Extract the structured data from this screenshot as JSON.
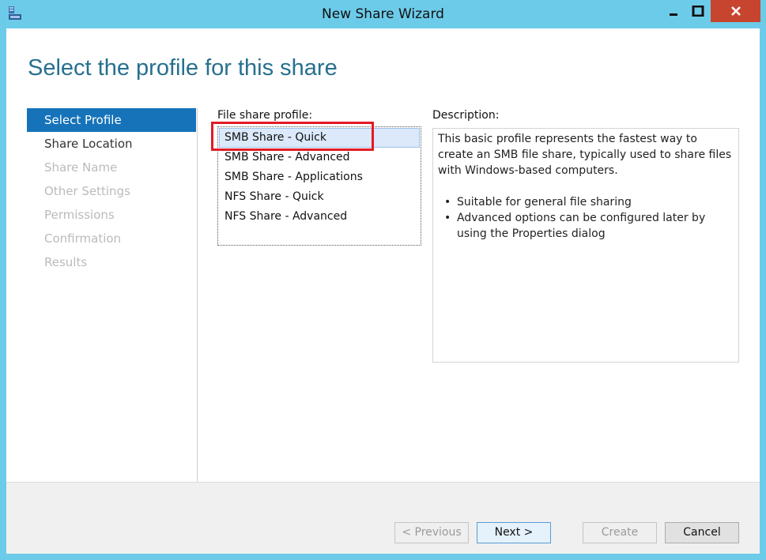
{
  "window": {
    "title": "New Share Wizard",
    "icon": "server-share-icon"
  },
  "heading": "Select the profile for this share",
  "steps": [
    {
      "label": "Select Profile",
      "state": "active"
    },
    {
      "label": "Share Location",
      "state": "enabled"
    },
    {
      "label": "Share Name",
      "state": "disabled"
    },
    {
      "label": "Other Settings",
      "state": "disabled"
    },
    {
      "label": "Permissions",
      "state": "disabled"
    },
    {
      "label": "Confirmation",
      "state": "disabled"
    },
    {
      "label": "Results",
      "state": "disabled"
    }
  ],
  "profiles": {
    "label": "File share profile:",
    "items": [
      {
        "label": "SMB Share - Quick",
        "selected": true
      },
      {
        "label": "SMB Share - Advanced",
        "selected": false
      },
      {
        "label": "SMB Share - Applications",
        "selected": false
      },
      {
        "label": "NFS Share - Quick",
        "selected": false
      },
      {
        "label": "NFS Share - Advanced",
        "selected": false
      }
    ]
  },
  "description": {
    "label": "Description:",
    "text": "This basic profile represents the fastest way to create an SMB file share, typically used to share files with Windows-based computers.",
    "bullets": [
      "Suitable for general file sharing",
      "Advanced options can be configured later by using the Properties dialog"
    ]
  },
  "buttons": {
    "previous": "< Previous",
    "next": "Next >",
    "create": "Create",
    "cancel": "Cancel"
  },
  "colors": {
    "titlebar": "#6dcbea",
    "close": "#c7452e",
    "heading": "#27708f",
    "active_step": "#1673b9",
    "highlight": "#e21b26"
  }
}
